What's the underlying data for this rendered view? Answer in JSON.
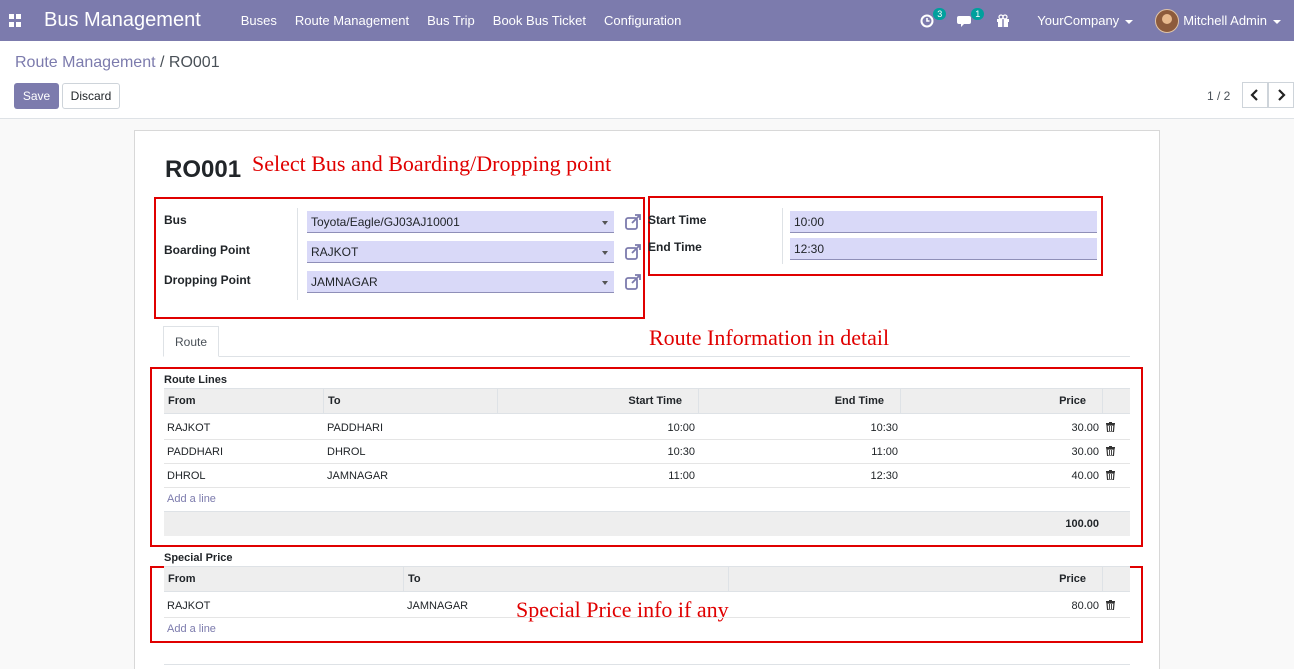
{
  "navbar": {
    "app_title": "Bus Management",
    "menu": [
      "Buses",
      "Route Management",
      "Bus Trip",
      "Book Bus Ticket",
      "Configuration"
    ],
    "activity_count": "3",
    "message_count": "1",
    "company": "YourCompany",
    "user": "Mitchell Admin"
  },
  "control": {
    "breadcrumb_parent": "Route Management",
    "breadcrumb_sep": "/",
    "breadcrumb_current": "RO001",
    "save_label": "Save",
    "discard_label": "Discard",
    "pager": "1 / 2"
  },
  "record": {
    "title": "RO001",
    "bus_label": "Bus",
    "bus_value": "Toyota/Eagle/GJ03AJ10001",
    "boarding_label": "Boarding Point",
    "boarding_value": "RAJKOT",
    "dropping_label": "Dropping Point",
    "dropping_value": "JAMNAGAR",
    "start_label": "Start Time",
    "start_value": "10:00",
    "end_label": "End Time",
    "end_value": "12:30"
  },
  "annotations": {
    "select": "Select Bus and Boarding/Dropping point",
    "route_info": "Route Information in detail",
    "special": "Special Price info if any"
  },
  "tabs": [
    "Route"
  ],
  "route_lines": {
    "title": "Route Lines",
    "columns": [
      "From",
      "To",
      "Start Time",
      "End Time",
      "Price"
    ],
    "rows": [
      {
        "from": "RAJKOT",
        "to": "PADDHARI",
        "start": "10:00",
        "end": "10:30",
        "price": "30.00"
      },
      {
        "from": "PADDHARI",
        "to": "DHROL",
        "start": "10:30",
        "end": "11:00",
        "price": "30.00"
      },
      {
        "from": "DHROL",
        "to": "JAMNAGAR",
        "start": "11:00",
        "end": "12:30",
        "price": "40.00"
      }
    ],
    "add_line": "Add a line",
    "total": "100.00"
  },
  "special_price": {
    "title": "Special Price",
    "columns": [
      "From",
      "To",
      "Price"
    ],
    "rows": [
      {
        "from": "RAJKOT",
        "to": "JAMNAGAR",
        "price": "80.00"
      }
    ],
    "add_line": "Add a line"
  },
  "colors": {
    "navbar": "#7c7bad",
    "annotation": "#e00000",
    "field_bg": "#d9d9f8"
  }
}
